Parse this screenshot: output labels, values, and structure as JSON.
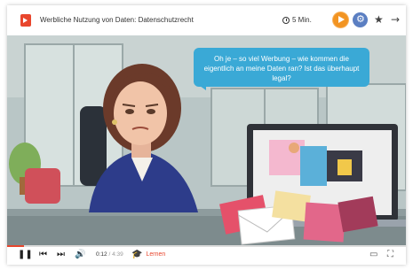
{
  "header": {
    "title": "Werbliche Nutzung von Daten: Datenschutzrecht",
    "duration": "5 Min.",
    "icons": [
      "document-play-icon",
      "clock-icon",
      "play-icon",
      "settings-icon",
      "star-icon",
      "arrow-right-icon",
      "close-icon"
    ]
  },
  "video": {
    "speech_bubble": "Oh je – so viel Werbung – wie kommen die eigentlich an meine Daten ran? Ist das überhaupt legal?"
  },
  "controls": {
    "current_time": "0:12",
    "separator": " / ",
    "total_time": "4:39",
    "progress": 0.043,
    "learn_label": "Lernen",
    "accent_color": "#e8462d",
    "icons": [
      "pause-icon",
      "skip-back-icon",
      "skip-forward-icon",
      "volume-icon",
      "graduation-cap-icon",
      "captions-icon",
      "fullscreen-icon"
    ]
  }
}
